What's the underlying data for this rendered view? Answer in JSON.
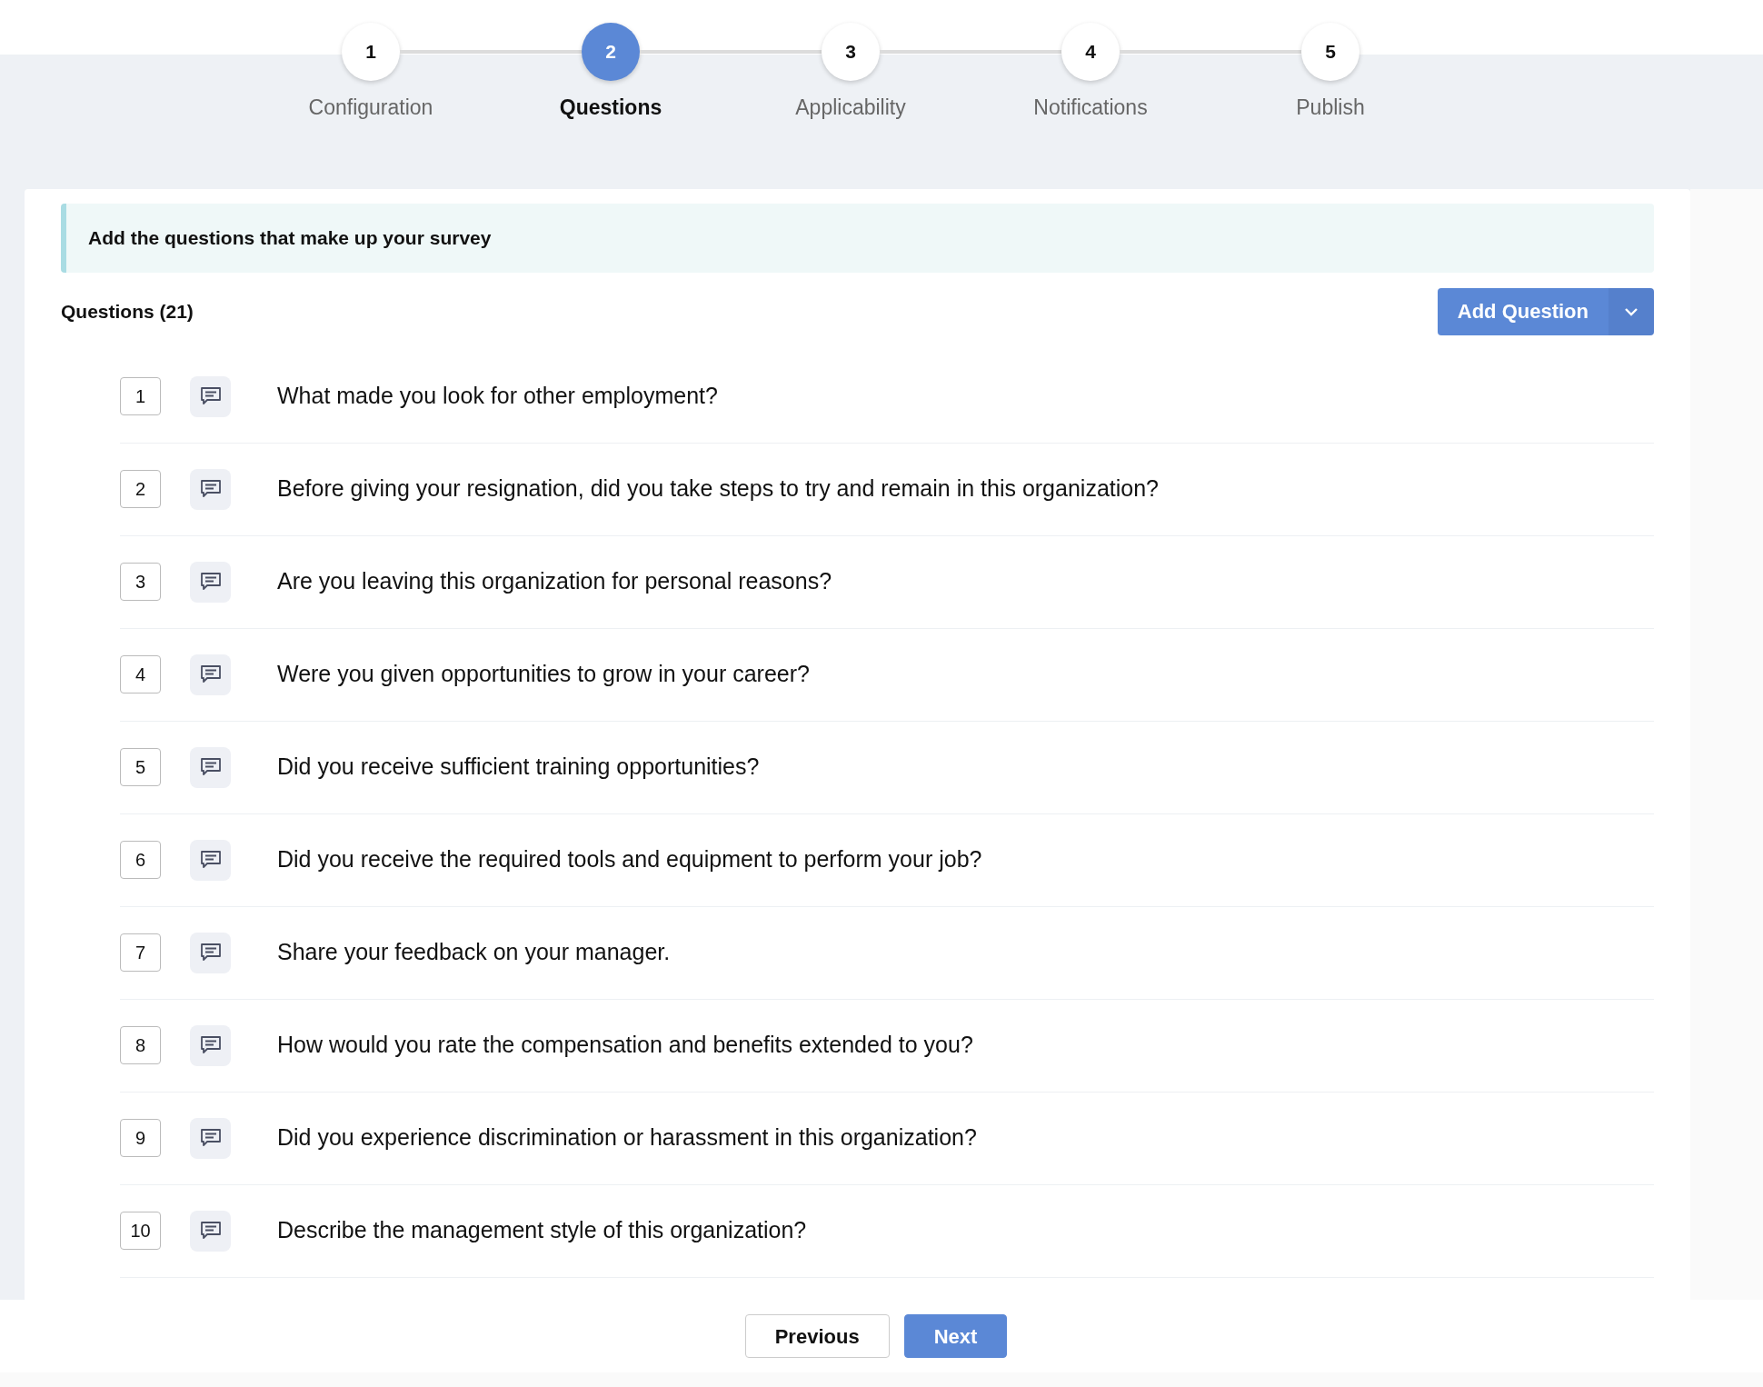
{
  "steps": [
    {
      "number": "1",
      "label": "Configuration",
      "selected": false
    },
    {
      "number": "2",
      "label": "Questions",
      "selected": true
    },
    {
      "number": "3",
      "label": "Applicability",
      "selected": false
    },
    {
      "number": "4",
      "label": "Notifications",
      "selected": false
    },
    {
      "number": "5",
      "label": "Publish",
      "selected": false
    }
  ],
  "banner": {
    "text": "Add the questions that make up your survey"
  },
  "questions_header": {
    "title": "Questions (21)",
    "add_button": "Add Question"
  },
  "questions": [
    {
      "number": "1",
      "text": "What made you look for other employment?"
    },
    {
      "number": "2",
      "text": "Before giving your resignation, did you take steps to try and remain in this organization?"
    },
    {
      "number": "3",
      "text": "Are you leaving this organization for personal reasons?"
    },
    {
      "number": "4",
      "text": "Were you given opportunities to grow in your career?"
    },
    {
      "number": "5",
      "text": "Did you receive sufficient training opportunities?"
    },
    {
      "number": "6",
      "text": "Did you receive the required tools and equipment to perform your job?"
    },
    {
      "number": "7",
      "text": "Share your feedback on your manager."
    },
    {
      "number": "8",
      "text": "How would you rate the compensation and benefits extended to you?"
    },
    {
      "number": "9",
      "text": "Did you experience discrimination or harassment in this organization?"
    },
    {
      "number": "10",
      "text": "Describe the management style of this organization?"
    }
  ],
  "footer": {
    "buttons": [
      {
        "label": "Previous",
        "kind": "secondary"
      },
      {
        "label": "Next",
        "kind": "primary"
      }
    ]
  }
}
